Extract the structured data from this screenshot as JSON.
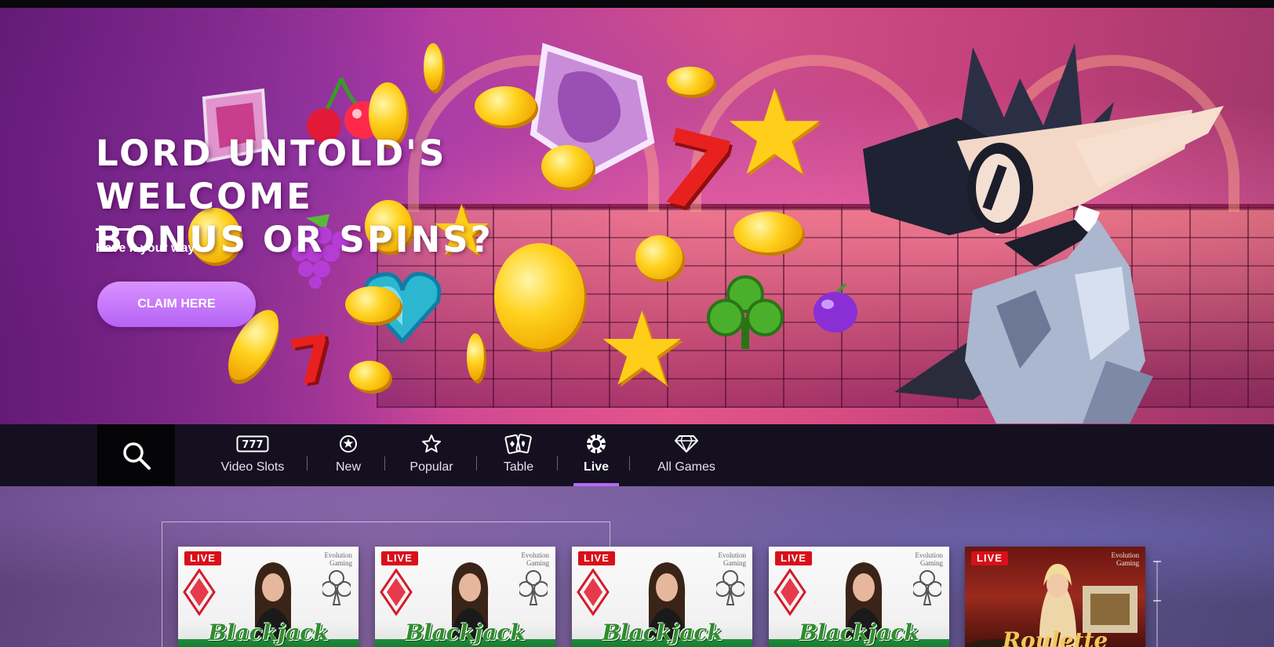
{
  "hero": {
    "title_line1": "LORD UNTOLD'S WELCOME",
    "title_line2": "BONUS OR SPINS?",
    "subtitle": "Have it your way",
    "cta_label": "CLAIM HERE",
    "cta_color": "#c37bf9"
  },
  "nav": {
    "search_icon": "search-icon",
    "tabs": [
      {
        "label": "Video Slots",
        "icon": "slots-777-icon"
      },
      {
        "label": "New",
        "icon": "new-burst-icon"
      },
      {
        "label": "Popular",
        "icon": "star-outline-icon"
      },
      {
        "label": "Table",
        "icon": "playing-cards-icon"
      },
      {
        "label": "Live",
        "icon": "roulette-chip-icon",
        "active": true
      },
      {
        "label": "All Games",
        "icon": "diamond-icon"
      }
    ],
    "video_slots_icon_text": "777",
    "active_color": "#b56af6"
  },
  "games": {
    "cards": [
      {
        "badge": "LIVE",
        "provider": "Evolution Gaming",
        "title": "Blackjack"
      },
      {
        "badge": "LIVE",
        "provider": "Evolution Gaming",
        "title": "Blackjack"
      },
      {
        "badge": "LIVE",
        "provider": "Evolution Gaming",
        "title": "Blackjack"
      },
      {
        "badge": "LIVE",
        "provider": "Evolution Gaming",
        "title": "Blackjack"
      },
      {
        "badge": "LIVE",
        "provider": "Evolution Gaming",
        "title": "Roulette"
      }
    ],
    "badge_color": "#d8101a"
  }
}
